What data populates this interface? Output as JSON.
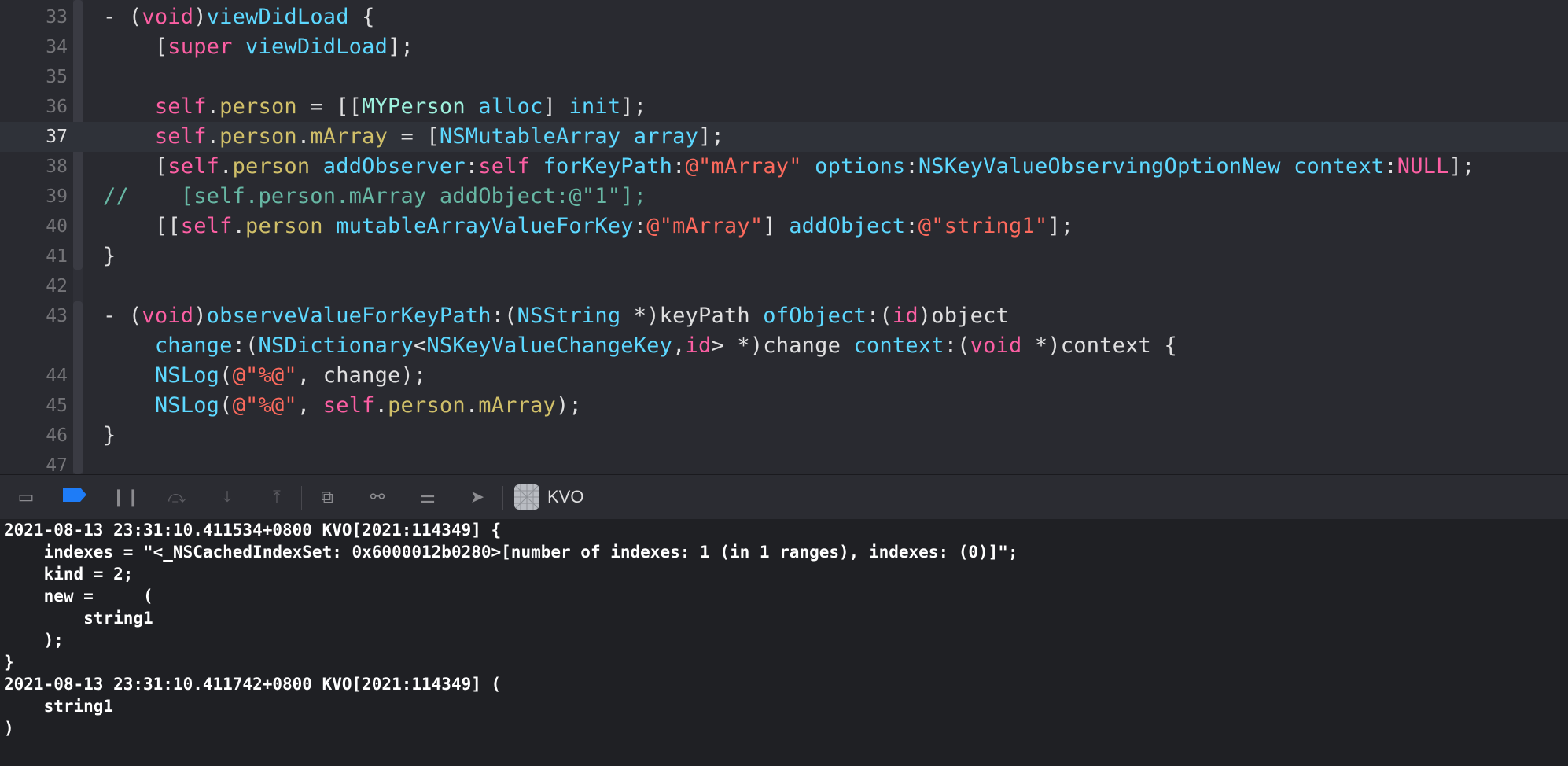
{
  "editor": {
    "current_line": "37",
    "lines": [
      {
        "ln": "33",
        "tokens": [
          [
            "t-plain",
            "- ("
          ],
          [
            "t-kw",
            "void"
          ],
          [
            "t-plain",
            ")"
          ],
          [
            "t-cls",
            "viewDidLoad"
          ],
          [
            "t-plain",
            " {"
          ]
        ]
      },
      {
        "ln": "34",
        "tokens": [
          [
            "t-plain",
            "    ["
          ],
          [
            "t-kw",
            "super"
          ],
          [
            "t-plain",
            " "
          ],
          [
            "t-cls",
            "viewDidLoad"
          ],
          [
            "t-plain",
            "];"
          ]
        ]
      },
      {
        "ln": "35",
        "tokens": []
      },
      {
        "ln": "36",
        "tokens": [
          [
            "t-plain",
            "    "
          ],
          [
            "t-kw",
            "self"
          ],
          [
            "t-plain",
            "."
          ],
          [
            "t-occ",
            "person"
          ],
          [
            "t-plain",
            " = [["
          ],
          [
            "t-type",
            "MYPerson"
          ],
          [
            "t-plain",
            " "
          ],
          [
            "t-cls",
            "alloc"
          ],
          [
            "t-plain",
            "] "
          ],
          [
            "t-cls",
            "init"
          ],
          [
            "t-plain",
            "];"
          ]
        ]
      },
      {
        "ln": "37",
        "tokens": [
          [
            "t-plain",
            "    "
          ],
          [
            "t-kw",
            "self"
          ],
          [
            "t-plain",
            "."
          ],
          [
            "t-occ",
            "person"
          ],
          [
            "t-plain",
            "."
          ],
          [
            "t-occ",
            "mArray"
          ],
          [
            "t-plain",
            " = ["
          ],
          [
            "t-cls",
            "NSMutableArray"
          ],
          [
            "t-plain",
            " "
          ],
          [
            "t-cls",
            "array"
          ],
          [
            "t-plain",
            "];"
          ]
        ]
      },
      {
        "ln": "38",
        "tokens": [
          [
            "t-plain",
            "    ["
          ],
          [
            "t-kw",
            "self"
          ],
          [
            "t-plain",
            "."
          ],
          [
            "t-occ",
            "person"
          ],
          [
            "t-plain",
            " "
          ],
          [
            "t-cls",
            "addObserver"
          ],
          [
            "t-plain",
            ":"
          ],
          [
            "t-kw",
            "self"
          ],
          [
            "t-plain",
            " "
          ],
          [
            "t-cls",
            "forKeyPath"
          ],
          [
            "t-plain",
            ":"
          ],
          [
            "t-str",
            "@\"mArray\""
          ],
          [
            "t-plain",
            " "
          ],
          [
            "t-cls",
            "options"
          ],
          [
            "t-plain",
            ":"
          ],
          [
            "t-cls",
            "NSKeyValueObservingOptionNew"
          ],
          [
            "t-plain",
            " "
          ],
          [
            "t-cls",
            "context"
          ],
          [
            "t-plain",
            ":"
          ],
          [
            "t-kw",
            "NULL"
          ],
          [
            "t-plain",
            "];"
          ]
        ]
      },
      {
        "ln": "39",
        "tokens": [
          [
            "t-mth",
            "//    [self.person.mArray addObject:@\"1\"];"
          ]
        ]
      },
      {
        "ln": "40",
        "tokens": [
          [
            "t-plain",
            "    [["
          ],
          [
            "t-kw",
            "self"
          ],
          [
            "t-plain",
            "."
          ],
          [
            "t-occ",
            "person"
          ],
          [
            "t-plain",
            " "
          ],
          [
            "t-cls",
            "mutableArrayValueForKey"
          ],
          [
            "t-plain",
            ":"
          ],
          [
            "t-str",
            "@\"mArray\""
          ],
          [
            "t-plain",
            "] "
          ],
          [
            "t-cls",
            "addObject"
          ],
          [
            "t-plain",
            ":"
          ],
          [
            "t-str",
            "@\"string1\""
          ],
          [
            "t-plain",
            "];"
          ]
        ]
      },
      {
        "ln": "41",
        "tokens": [
          [
            "t-plain",
            "}"
          ]
        ]
      },
      {
        "ln": "42",
        "tokens": []
      },
      {
        "ln": "43",
        "tokens": [
          [
            "t-plain",
            "- ("
          ],
          [
            "t-kw",
            "void"
          ],
          [
            "t-plain",
            ")"
          ],
          [
            "t-cls",
            "observeValueForKeyPath"
          ],
          [
            "t-plain",
            ":("
          ],
          [
            "t-cls",
            "NSString"
          ],
          [
            "t-plain",
            " *)keyPath "
          ],
          [
            "t-cls",
            "ofObject"
          ],
          [
            "t-plain",
            ":("
          ],
          [
            "t-kw",
            "id"
          ],
          [
            "t-plain",
            ")object"
          ]
        ]
      },
      {
        "ln": "",
        "tokens": [
          [
            "t-plain",
            "    "
          ],
          [
            "t-cls",
            "change"
          ],
          [
            "t-plain",
            ":("
          ],
          [
            "t-cls",
            "NSDictionary"
          ],
          [
            "t-plain",
            "<"
          ],
          [
            "t-cls",
            "NSKeyValueChangeKey"
          ],
          [
            "t-plain",
            ","
          ],
          [
            "t-kw",
            "id"
          ],
          [
            "t-plain",
            "> *)change "
          ],
          [
            "t-cls",
            "context"
          ],
          [
            "t-plain",
            ":("
          ],
          [
            "t-kw",
            "void"
          ],
          [
            "t-plain",
            " *)context {"
          ]
        ]
      },
      {
        "ln": "44",
        "tokens": [
          [
            "t-plain",
            "    "
          ],
          [
            "t-cls",
            "NSLog"
          ],
          [
            "t-plain",
            "("
          ],
          [
            "t-str",
            "@\"%@\""
          ],
          [
            "t-plain",
            ", change);"
          ]
        ]
      },
      {
        "ln": "45",
        "tokens": [
          [
            "t-plain",
            "    "
          ],
          [
            "t-cls",
            "NSLog"
          ],
          [
            "t-plain",
            "("
          ],
          [
            "t-str",
            "@\"%@\""
          ],
          [
            "t-plain",
            ", "
          ],
          [
            "t-kw",
            "self"
          ],
          [
            "t-plain",
            "."
          ],
          [
            "t-occ",
            "person"
          ],
          [
            "t-plain",
            "."
          ],
          [
            "t-occ",
            "mArray"
          ],
          [
            "t-plain",
            ");"
          ]
        ]
      },
      {
        "ln": "46",
        "tokens": [
          [
            "t-plain",
            "}"
          ]
        ]
      },
      {
        "ln": "47",
        "tokens": []
      }
    ]
  },
  "debug_bar": {
    "buttons": [
      {
        "name": "hide-debug-area-button",
        "icon": "panel-icon",
        "glyph": "▭",
        "state": "normal"
      },
      {
        "name": "breakpoints-toggle-button",
        "icon": "breakpoint-icon",
        "glyph": "",
        "state": "active"
      },
      {
        "name": "pause-button",
        "icon": "pause-icon",
        "glyph": "❙❙",
        "state": "normal"
      },
      {
        "name": "step-over-button",
        "icon": "step-over-icon",
        "glyph": "⤼",
        "state": "dim"
      },
      {
        "name": "step-into-button",
        "icon": "step-into-icon",
        "glyph": "⤓",
        "state": "dim"
      },
      {
        "name": "step-out-button",
        "icon": "step-out-icon",
        "glyph": "⤒",
        "state": "dim"
      },
      {
        "name": "view-hierarchy-button",
        "icon": "view-hierarchy-icon",
        "glyph": "⧉",
        "state": "normal"
      },
      {
        "name": "memory-graph-button",
        "icon": "memory-graph-icon",
        "glyph": "⚯",
        "state": "normal"
      },
      {
        "name": "environment-overrides-button",
        "icon": "toggles-icon",
        "glyph": "⚌",
        "state": "normal"
      },
      {
        "name": "simulate-location-button",
        "icon": "location-arrow-icon",
        "glyph": "➤",
        "state": "normal"
      }
    ],
    "target_label": "KVO"
  },
  "console": {
    "lines": [
      "2021-08-13 23:31:10.411534+0800 KVO[2021:114349] {",
      "    indexes = \"<_NSCachedIndexSet: 0x6000012b0280>[number of indexes: 1 (in 1 ranges), indexes: (0)]\";",
      "    kind = 2;",
      "    new =     (",
      "        string1",
      "    );",
      "}",
      "2021-08-13 23:31:10.411742+0800 KVO[2021:114349] (",
      "    string1",
      ")"
    ]
  }
}
